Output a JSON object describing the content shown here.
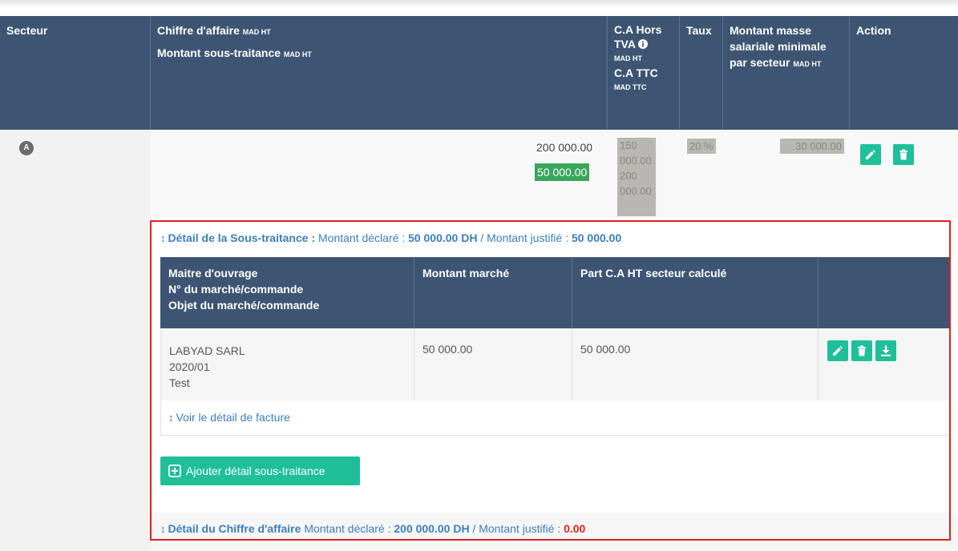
{
  "main_table": {
    "headers": {
      "secteur": "Secteur",
      "ca_line1": "Chiffre d'affaire",
      "ca_line1_unit": "MAD HT",
      "ca_line2": "Montant sous-traitance",
      "ca_line2_unit": "MAD HT",
      "ht_line1": "C.A Hors",
      "ht_line2": "TVA",
      "ht_unit": "MAD HT",
      "ttc_label": "C.A TTC",
      "ttc_unit": "MAD TTC",
      "taux": "Taux",
      "masse_line1": "Montant masse",
      "masse_line2": "salariale minimale",
      "masse_line3": "par secteur",
      "masse_unit": "MAD HT",
      "action": "Action"
    },
    "row": {
      "secteur_badge": "A",
      "chiffre_affaire": "200 000.00",
      "sous_traitance": "50 000.00",
      "ca_ht_1": "150",
      "ca_ht_2": "000.00",
      "ca_ttc_1": "200",
      "ca_ttc_2": "000.00",
      "taux": "20 %",
      "masse": "30 000.00"
    }
  },
  "sous_traitance_detail": {
    "title": "Détail de la Sous-traitance :",
    "declared_label": "Montant déclaré :",
    "declared_value": "50 000.00 DH",
    "separator": "/",
    "justified_label": "Montant justifié :",
    "justified_value": "50 000.00",
    "table": {
      "headers": {
        "maitre": "Maitre d'ouvrage",
        "numero": "N° du marché/commande",
        "objet": "Objet du marché/commande",
        "montant": "Montant marché",
        "part": "Part C.A HT secteur calculé"
      },
      "rows": [
        {
          "maitre": "LABYAD SARL",
          "numero": "2020/01",
          "objet": "Test",
          "montant": "50 000.00",
          "part": "50 000.00"
        }
      ]
    },
    "voir_facture": "Voir le détail de facture",
    "add_button": "Ajouter détail sous-traitance"
  },
  "chiffre_affaire_detail": {
    "title": "Détail du Chiffre d'affaire",
    "declared_label": "Montant déclaré :",
    "declared_value": "200 000.00 DH",
    "separator": "/",
    "justified_label": "Montant justifié :",
    "justified_value": "0.00"
  },
  "colors": {
    "header_bg": "#3d5573",
    "action_green": "#1fbf9a",
    "chip_green": "#3aa55b",
    "link_blue": "#3a7fbf",
    "highlight_red": "#e02020"
  },
  "icons": {
    "edit": "pencil-icon",
    "delete": "trash-icon",
    "download": "download-icon",
    "add": "plus-square-icon",
    "info": "info-circle-icon",
    "expand": "vertical-arrows-icon"
  }
}
